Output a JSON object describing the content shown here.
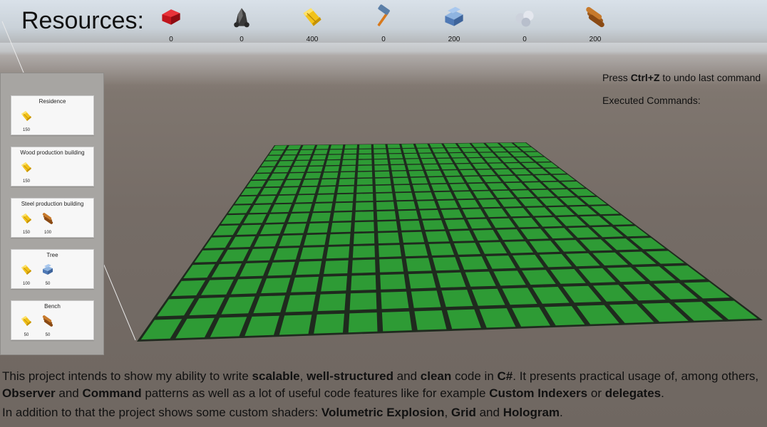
{
  "resources": {
    "title": "Resources:",
    "items": [
      {
        "icon": "ruby-icon",
        "value": "0"
      },
      {
        "icon": "coal-icon",
        "value": "0"
      },
      {
        "icon": "gold-ingot-icon",
        "value": "400"
      },
      {
        "icon": "hammer-icon",
        "value": "0"
      },
      {
        "icon": "steel-icon",
        "value": "200"
      },
      {
        "icon": "stone-icon",
        "value": "0"
      },
      {
        "icon": "wood-logs-icon",
        "value": "200"
      }
    ]
  },
  "buildings": [
    {
      "name": "Residence",
      "costs": [
        {
          "icon": "gold-ingot-icon",
          "value": "150"
        }
      ]
    },
    {
      "name": "Wood production building",
      "costs": [
        {
          "icon": "gold-ingot-icon",
          "value": "150"
        }
      ]
    },
    {
      "name": "Steel production building",
      "costs": [
        {
          "icon": "gold-ingot-icon",
          "value": "150"
        },
        {
          "icon": "wood-logs-icon",
          "value": "100"
        }
      ]
    },
    {
      "name": "Tree",
      "costs": [
        {
          "icon": "gold-ingot-icon",
          "value": "100"
        },
        {
          "icon": "steel-icon",
          "value": "50"
        }
      ]
    },
    {
      "name": "Bench",
      "costs": [
        {
          "icon": "gold-ingot-icon",
          "value": "50"
        },
        {
          "icon": "wood-logs-icon",
          "value": "50"
        }
      ]
    }
  ],
  "help": {
    "prefix": "Press ",
    "keys": "Ctrl+Z",
    "suffix": " to undo last command",
    "executed_label": "Executed Commands:"
  },
  "description": {
    "p1": [
      {
        "t": "This project intends to show my ability to write ",
        "b": false
      },
      {
        "t": "scalable",
        "b": true
      },
      {
        "t": ", ",
        "b": false
      },
      {
        "t": "well-structured",
        "b": true
      },
      {
        "t": " and ",
        "b": false
      },
      {
        "t": "clean",
        "b": true
      },
      {
        "t": " code in ",
        "b": false
      },
      {
        "t": "C#",
        "b": true
      },
      {
        "t": ". It presents practical usage of, among others, ",
        "b": false
      },
      {
        "t": "Observer",
        "b": true
      },
      {
        "t": " and ",
        "b": false
      },
      {
        "t": "Command",
        "b": true
      },
      {
        "t": " patterns as well as a lot of useful code features like for example ",
        "b": false
      },
      {
        "t": "Custom Indexers",
        "b": true
      },
      {
        "t": " or ",
        "b": false
      },
      {
        "t": "delegates",
        "b": true
      },
      {
        "t": ".",
        "b": false
      }
    ],
    "p2": [
      {
        "t": "In addition to that the project shows some custom shaders: ",
        "b": false
      },
      {
        "t": "Volumetric Explosion",
        "b": true
      },
      {
        "t": ", ",
        "b": false
      },
      {
        "t": "Grid",
        "b": true
      },
      {
        "t": " and ",
        "b": false
      },
      {
        "t": "Hologram",
        "b": true
      },
      {
        "t": ".",
        "b": false
      }
    ]
  },
  "grid": {
    "columns": 18,
    "rows": 18,
    "tile_color": "#2e9b35",
    "line_color": "#1f2a1e"
  },
  "colors": {
    "sidebar": "#a7a5a2",
    "card": "#f7f7f7"
  }
}
